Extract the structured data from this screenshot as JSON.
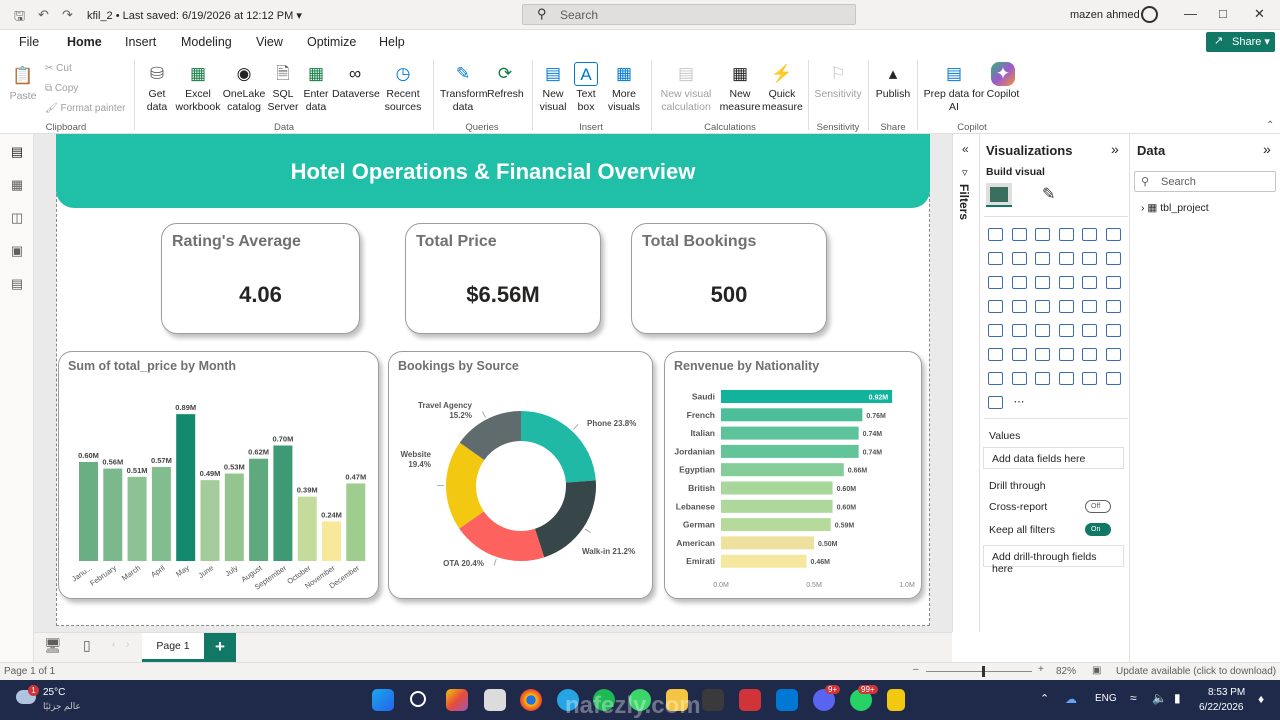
{
  "app": {
    "file_name": "kfil_2",
    "saved_status": "Last saved: 6/19/2026 at 12:12 PM",
    "search_placeholder": "Search",
    "user_name": "mazen ahmed"
  },
  "menu": [
    "File",
    "Home",
    "Insert",
    "Modeling",
    "View",
    "Optimize",
    "Help"
  ],
  "active_menu": "Home",
  "share_label": "Share",
  "ribbon": {
    "clipboard": {
      "paste": "Paste",
      "cut": "Cut",
      "copy": "Copy",
      "format_painter": "Format painter",
      "group": "Clipboard"
    },
    "data": {
      "get_data": "Get data",
      "excel": "Excel workbook",
      "onelake": "OneLake catalog",
      "sql": "SQL Server",
      "enter": "Enter data",
      "dataverse": "Dataverse",
      "recent": "Recent sources",
      "group": "Data"
    },
    "queries": {
      "transform": "Transform data",
      "refresh": "Refresh",
      "group": "Queries"
    },
    "insert": {
      "new_visual": "New visual",
      "text_box": "Text box",
      "more_visuals": "More visuals",
      "group": "Insert"
    },
    "calculations": {
      "new_visual_calc": "New visual calculation",
      "new_measure": "New measure",
      "quick_measure": "Quick measure",
      "group": "Calculations"
    },
    "sensitivity": {
      "label": "Sensitivity",
      "group": "Sensitivity"
    },
    "share": {
      "publish": "Publish",
      "group": "Share"
    },
    "copilot": {
      "prep": "Prep data for AI",
      "copilot": "Copilot",
      "group": "Copilot"
    }
  },
  "report": {
    "title": "Hotel Operations & Financial Overview",
    "kpis": [
      {
        "title": "Rating's Average",
        "value": "4.06"
      },
      {
        "title": "Total Price",
        "value": "$6.56M"
      },
      {
        "title": "Total Bookings",
        "value": "500"
      }
    ],
    "chart_titles": [
      "Sum of total_price by Month",
      "Bookings by Source",
      "Renvenue by Nationality"
    ]
  },
  "chart_data": [
    {
      "type": "bar",
      "title": "Sum of total_price by Month",
      "categories": [
        "Janu...",
        "February",
        "March",
        "April",
        "May",
        "June",
        "July",
        "August",
        "September",
        "October",
        "November",
        "December"
      ],
      "values": [
        0.6,
        0.56,
        0.51,
        0.57,
        0.89,
        0.49,
        0.53,
        0.62,
        0.7,
        0.39,
        0.24,
        0.47
      ],
      "labels": [
        "0.60M",
        "0.56M",
        "0.51M",
        "0.57M",
        "0.89M",
        "0.49M",
        "0.53M",
        "0.62M",
        "0.70M",
        "0.39M",
        "0.24M",
        "0.47M"
      ],
      "colors": [
        "#6aaf84",
        "#7bb98c",
        "#8cc294",
        "#82bd90",
        "#138a6e",
        "#a3cc9a",
        "#94c591",
        "#5fa97f",
        "#3e9a75",
        "#c3dc9b",
        "#f7e89a",
        "#9fcc8f"
      ],
      "ylim": [
        0,
        1.0
      ]
    },
    {
      "type": "pie",
      "title": "Bookings by Source",
      "slices": [
        {
          "name": "Phone",
          "value": 23.8,
          "label": "Phone 23.8%",
          "color": "#20b9a6"
        },
        {
          "name": "Walk-in",
          "value": 21.2,
          "label": "Walk-in 21.2%",
          "color": "#374649"
        },
        {
          "name": "OTA",
          "value": 20.4,
          "label": "OTA 20.4%",
          "color": "#fd625e"
        },
        {
          "name": "Website",
          "value": 19.4,
          "label": "Website\n19.4%",
          "color": "#f2c811"
        },
        {
          "name": "Travel Agency",
          "value": 15.2,
          "label": "Travel Agency\n15.2%",
          "color": "#5f6b6d"
        }
      ]
    },
    {
      "type": "bar",
      "title": "Renvenue by Nationality",
      "orientation": "horizontal",
      "categories": [
        "Saudi",
        "French",
        "Italian",
        "Jordanian",
        "Egyptian",
        "British",
        "Lebanese",
        "German",
        "American",
        "Emirati"
      ],
      "values": [
        0.92,
        0.76,
        0.74,
        0.74,
        0.66,
        0.6,
        0.6,
        0.59,
        0.5,
        0.46
      ],
      "labels": [
        "0.92M",
        "0.76M",
        "0.74M",
        "0.74M",
        "0.66M",
        "0.60M",
        "0.60M",
        "0.59M",
        "0.50M",
        "0.46M"
      ],
      "colors": [
        "#11b39c",
        "#4cbf9a",
        "#5cc39a",
        "#62c59a",
        "#84cc98",
        "#a8d79b",
        "#acd89b",
        "#b6da9b",
        "#efe09d",
        "#f6e79f"
      ],
      "xticks": [
        "0.0M",
        "0.5M",
        "1.0M"
      ],
      "xlim": [
        0,
        1.0
      ]
    }
  ],
  "filters_label": "Filters",
  "visualizations": {
    "title": "Visualizations",
    "build_visual": "Build visual",
    "values_label": "Values",
    "add_data": "Add data fields here",
    "drill_through": "Drill through",
    "cross_report": "Cross-report",
    "cross_report_state": "Off",
    "keep_filters": "Keep all filters",
    "keep_filters_state": "On",
    "add_drill": "Add drill-through fields here"
  },
  "data_pane": {
    "title": "Data",
    "search_placeholder": "Search",
    "table": "tbl_project"
  },
  "page_tab": "Page 1",
  "status": {
    "page": "Page 1 of 1",
    "zoom": "82%",
    "update": "Update available (click to download)"
  },
  "taskbar": {
    "weather_temp": "25°C",
    "weather_text": "عالم جزئيًا",
    "lang": "ENG",
    "time": "8:53 PM",
    "date": "6/22/2026",
    "badge_weather": "1",
    "badge_discord": "9+",
    "badge_whatsapp": "99+"
  },
  "watermark": "nafezly.com"
}
